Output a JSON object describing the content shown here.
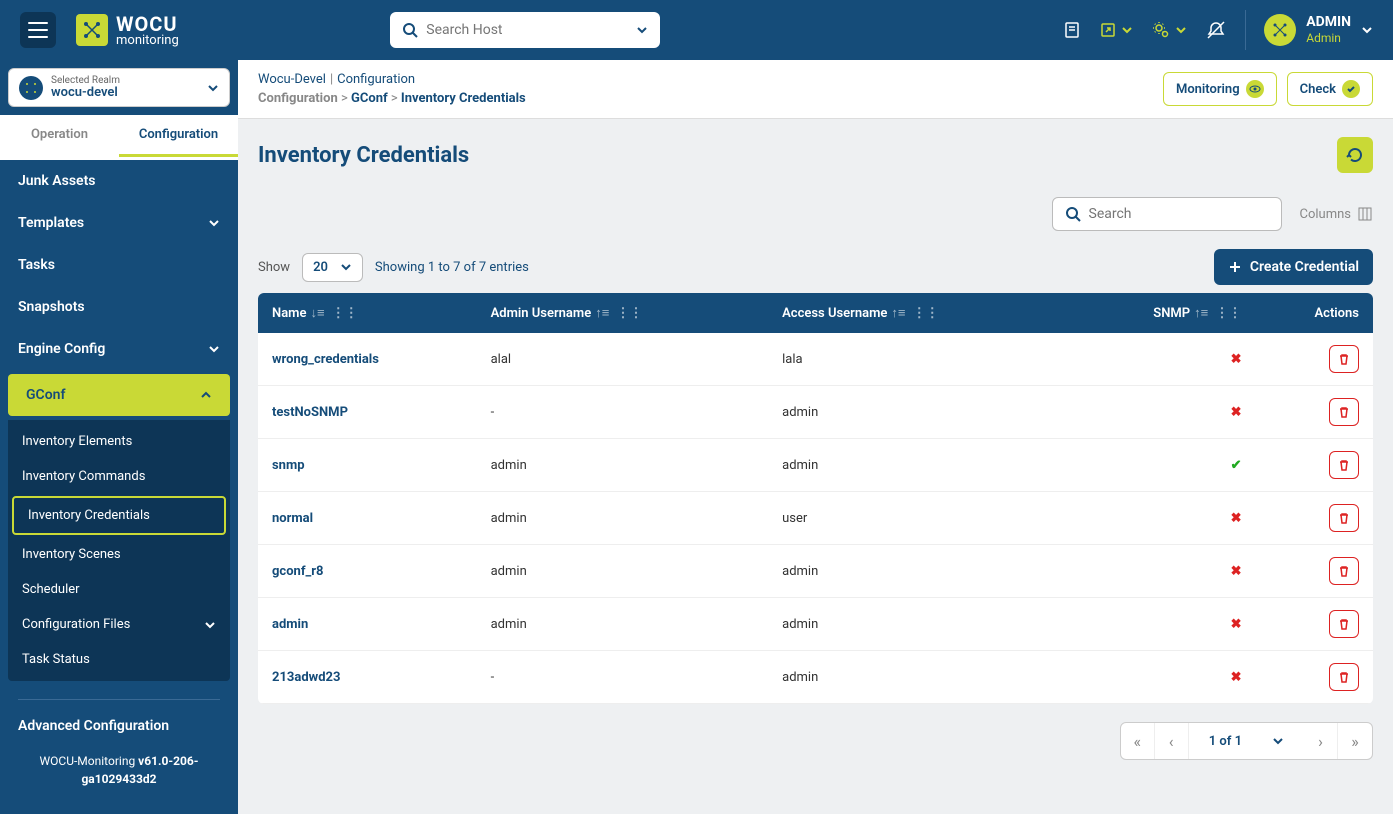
{
  "header": {
    "logo_main": "WOCU",
    "logo_sub": "monitoring",
    "search_placeholder": "Search Host",
    "user_name": "ADMIN",
    "user_role": "Admin"
  },
  "realm": {
    "label": "Selected Realm",
    "value": "wocu-devel"
  },
  "tabs": {
    "operation": "Operation",
    "configuration": "Configuration"
  },
  "nav": {
    "junk_assets": "Junk Assets",
    "templates": "Templates",
    "tasks": "Tasks",
    "snapshots": "Snapshots",
    "engine_config": "Engine Config",
    "gconf": "GConf",
    "gconf_items": {
      "inv_elements": "Inventory Elements",
      "inv_commands": "Inventory Commands",
      "inv_credentials": "Inventory Credentials",
      "inv_scenes": "Inventory Scenes",
      "scheduler": "Scheduler",
      "conf_files": "Configuration Files",
      "task_status": "Task Status"
    },
    "advanced": "Advanced Configuration",
    "version_pre": "WOCU-Monitoring ",
    "version": "v61.0-206-ga1029433d2"
  },
  "breadcrumb": {
    "a": "Wocu-Devel",
    "b": "Configuration",
    "c": "Configuration",
    "d": "GConf",
    "e": "Inventory Credentials"
  },
  "topbtns": {
    "monitoring": "Monitoring",
    "check": "Check"
  },
  "page": {
    "title": "Inventory Credentials",
    "search_placeholder": "Search",
    "columns": "Columns",
    "show": "Show",
    "show_value": "20",
    "showing": "Showing 1 to 7 of 7 entries",
    "create": "Create Credential",
    "cols": {
      "name": "Name",
      "admin": "Admin Username",
      "access": "Access Username",
      "snmp": "SNMP",
      "actions": "Actions"
    },
    "rows": [
      {
        "name": "wrong_credentials",
        "admin": "alal",
        "access": "lala",
        "snmp": false
      },
      {
        "name": "testNoSNMP",
        "admin": "-",
        "access": "admin",
        "snmp": false
      },
      {
        "name": "snmp",
        "admin": "admin",
        "access": "admin",
        "snmp": true
      },
      {
        "name": "normal",
        "admin": "admin",
        "access": "user",
        "snmp": false
      },
      {
        "name": "gconf_r8",
        "admin": "admin",
        "access": "admin",
        "snmp": false
      },
      {
        "name": "admin",
        "admin": "admin",
        "access": "admin",
        "snmp": false
      },
      {
        "name": "213adwd23",
        "admin": "-",
        "access": "admin",
        "snmp": false
      }
    ],
    "pager": "1 of 1"
  }
}
